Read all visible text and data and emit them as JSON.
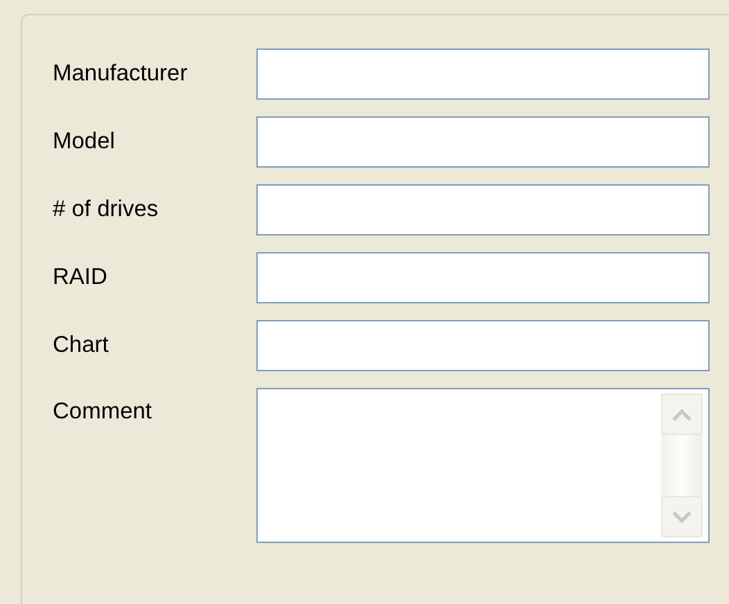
{
  "fields": [
    {
      "label": "Manufacturer",
      "kind": "text"
    },
    {
      "label": "Model",
      "kind": "text"
    },
    {
      "label": "# of drives",
      "kind": "text"
    },
    {
      "label": "RAID",
      "kind": "text"
    },
    {
      "label": "Chart",
      "kind": "text"
    },
    {
      "label": "Comment",
      "kind": "multiline"
    }
  ]
}
